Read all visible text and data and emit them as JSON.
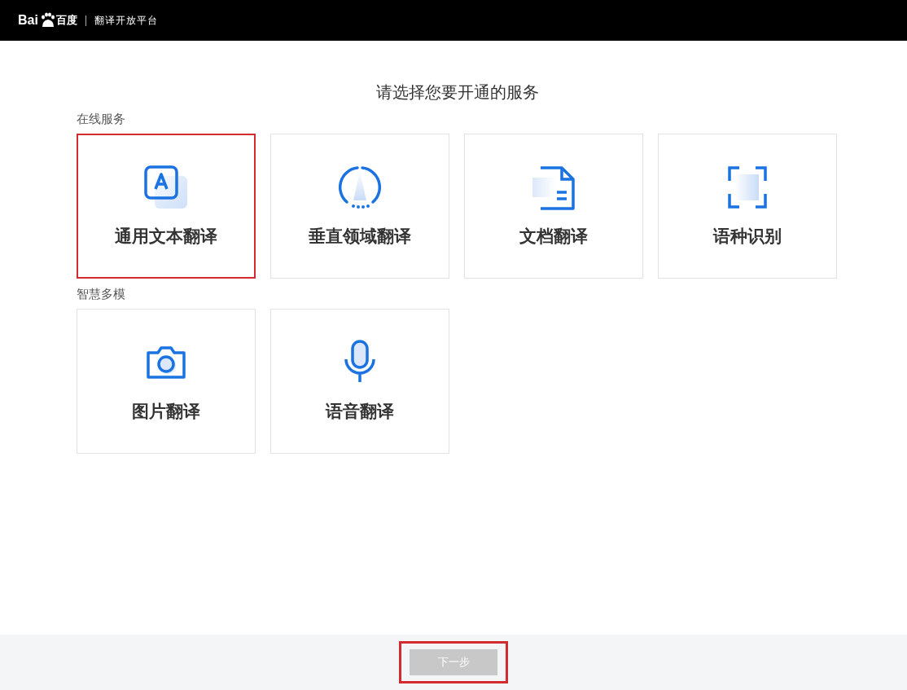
{
  "header": {
    "logo": {
      "latin": "Bai",
      "chinese": "百度"
    },
    "product": "翻译开放平台"
  },
  "title": "请选择您要开通的服务",
  "sections": [
    {
      "label": "在线服务",
      "services": [
        {
          "kind": "text",
          "label": "通用文本翻译",
          "selected": true
        },
        {
          "kind": "domain",
          "label": "垂直领域翻译",
          "selected": false
        },
        {
          "kind": "document",
          "label": "文档翻译",
          "selected": false
        },
        {
          "kind": "language",
          "label": "语种识别",
          "selected": false
        }
      ]
    },
    {
      "label": "智慧多模",
      "services": [
        {
          "kind": "image",
          "label": "图片翻译",
          "selected": false
        },
        {
          "kind": "speech",
          "label": "语音翻译",
          "selected": false
        }
      ]
    }
  ],
  "footer": {
    "next_button": {
      "label": "下一步",
      "disabled": true,
      "highlighted": true
    }
  }
}
